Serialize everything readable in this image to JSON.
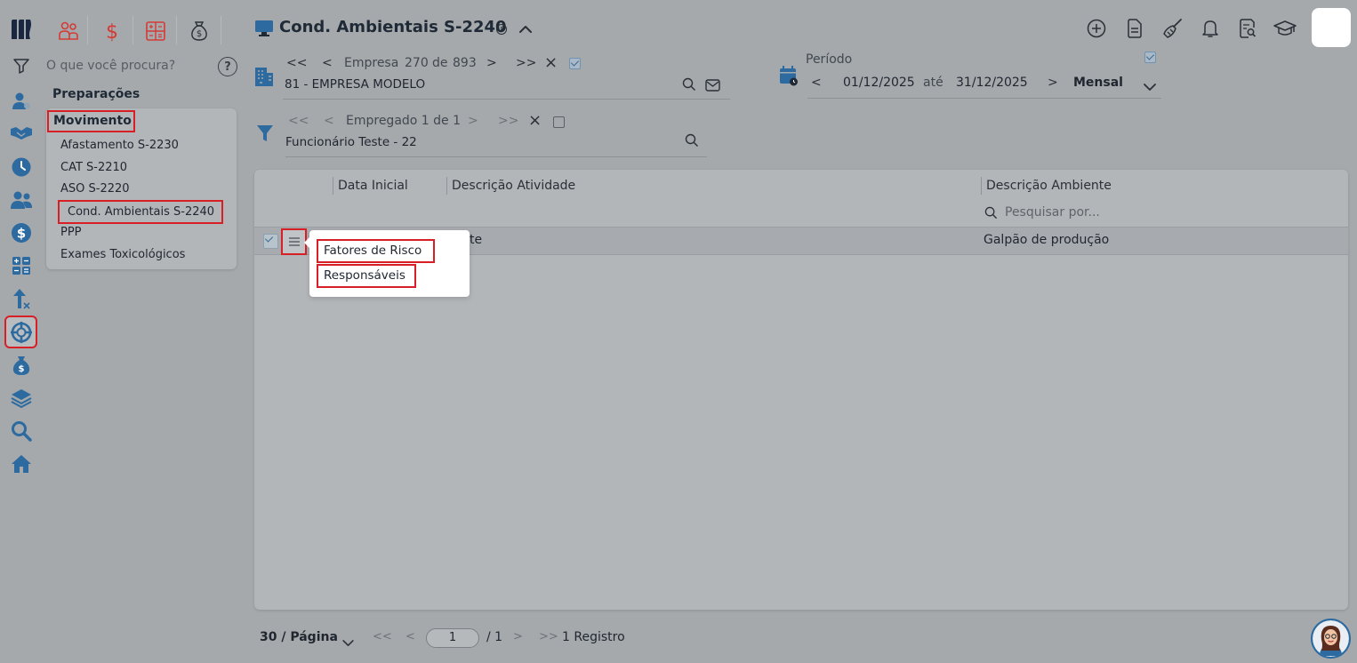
{
  "sidebar": {
    "search_placeholder": "O que você procura?",
    "help": "?",
    "section": "Preparações",
    "group": "Movimento",
    "items": [
      {
        "label": "Afastamento S-2230"
      },
      {
        "label": "CAT S-2210"
      },
      {
        "label": "ASO S-2220"
      },
      {
        "label": "Cond. Ambientais S-2240"
      },
      {
        "label": "PPP"
      },
      {
        "label": "Exames Toxicológicos"
      }
    ]
  },
  "header": {
    "title": "Cond. Ambientais S-2240",
    "info": "i"
  },
  "empresa": {
    "first": "<<",
    "prev": "<",
    "label": "Empresa",
    "index": "270",
    "of": "de",
    "total": "893",
    "next": ">",
    "last": ">>",
    "clear": "×",
    "value": "81 - EMPRESA MODELO"
  },
  "empregado": {
    "first": "<<",
    "prev": "<",
    "label": "Empregado 1 de 1",
    "next": ">",
    "last": ">>",
    "clear": "×",
    "value": "Funcionário Teste - 22"
  },
  "periodo": {
    "label": "Período",
    "prev": "<",
    "start": "01/12/2025",
    "sep": "até",
    "end": "31/12/2025",
    "next": ">",
    "mode": "Mensal"
  },
  "grid": {
    "columns": [
      "Data Inicial",
      "Descrição Atividade",
      "Descrição Ambiente"
    ],
    "search_placeholder": "Pesquisar por...",
    "rows": [
      {
        "atividade_suffix": "te",
        "ambiente": "Galpão de produção"
      }
    ],
    "row_menu": [
      "Fatores de Risco",
      "Responsáveis"
    ]
  },
  "footer": {
    "per_page": "30 / Página",
    "first": "<<",
    "prev": "<",
    "page": "1",
    "of": "/ 1",
    "next": ">",
    "last": ">>",
    "records": "1 Registro"
  },
  "colors": {
    "accent": "#2c6aa0",
    "highlight_box": "#d81f26",
    "module_red": "#d43a35"
  }
}
